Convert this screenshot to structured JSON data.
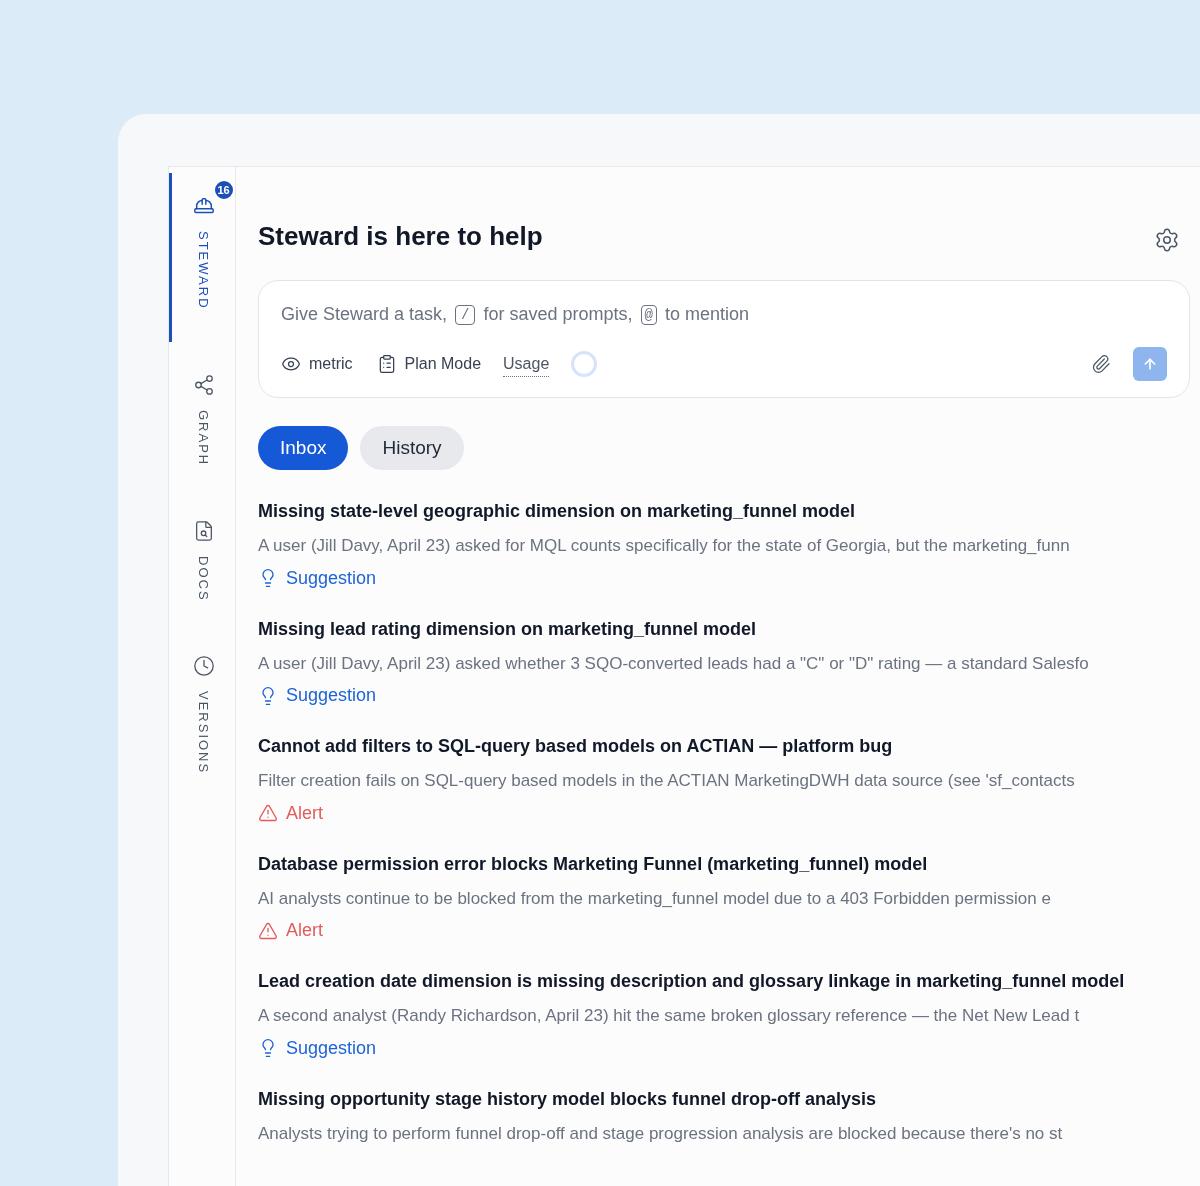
{
  "sidebar": {
    "items": [
      {
        "label": "STEWARD",
        "kind": "helmet",
        "selected": true,
        "badge": "16"
      },
      {
        "label": "GRAPH",
        "kind": "share",
        "selected": false
      },
      {
        "label": "DOCS",
        "kind": "doc",
        "selected": false
      },
      {
        "label": "VERSIONS",
        "kind": "clock",
        "selected": false
      }
    ]
  },
  "header": {
    "title": "Steward is here to help"
  },
  "composer": {
    "placeholder_parts": [
      "Give Steward a task,",
      "/",
      "for saved prompts,",
      "@",
      "to mention"
    ],
    "metric": "metric",
    "plan_mode": "Plan Mode",
    "usage": "Usage"
  },
  "tabs": [
    {
      "label": "Inbox",
      "selected": true
    },
    {
      "label": "History",
      "selected": false
    }
  ],
  "items": [
    {
      "title": "Missing state-level geographic dimension on marketing_funnel model",
      "description": "A user (Jill Davy, April 23) asked for MQL counts specifically for the state of Georgia, but the marketing_funn",
      "tag": {
        "kind": "suggestion",
        "label": "Suggestion"
      }
    },
    {
      "title": "Missing lead rating dimension on marketing_funnel model",
      "description": "A user (Jill Davy, April 23) asked whether 3 SQO-converted leads had a \"C\" or \"D\" rating — a standard Salesfo",
      "tag": {
        "kind": "suggestion",
        "label": "Suggestion"
      }
    },
    {
      "title": "Cannot add filters to SQL-query based models on ACTIAN — platform bug",
      "description": "Filter creation fails on SQL-query based models in the ACTIAN MarketingDWH data source (see 'sf_contacts",
      "tag": {
        "kind": "alert",
        "label": "Alert"
      }
    },
    {
      "title": "Database permission error blocks Marketing Funnel (marketing_funnel) model",
      "description": "AI analysts continue to be blocked from the marketing_funnel model due to a 403 Forbidden permission e",
      "tag": {
        "kind": "alert",
        "label": "Alert"
      }
    },
    {
      "title": "Lead creation date dimension is missing description and glossary linkage in marketing_funnel model",
      "description": "A second analyst (Randy Richardson, April 23) hit the same broken glossary reference — the Net New Lead t",
      "tag": {
        "kind": "suggestion",
        "label": "Suggestion"
      }
    },
    {
      "title": "Missing opportunity stage history model blocks funnel drop-off analysis",
      "description": "Analysts trying to perform funnel drop-off and stage progression analysis are blocked because there's no st"
    }
  ]
}
